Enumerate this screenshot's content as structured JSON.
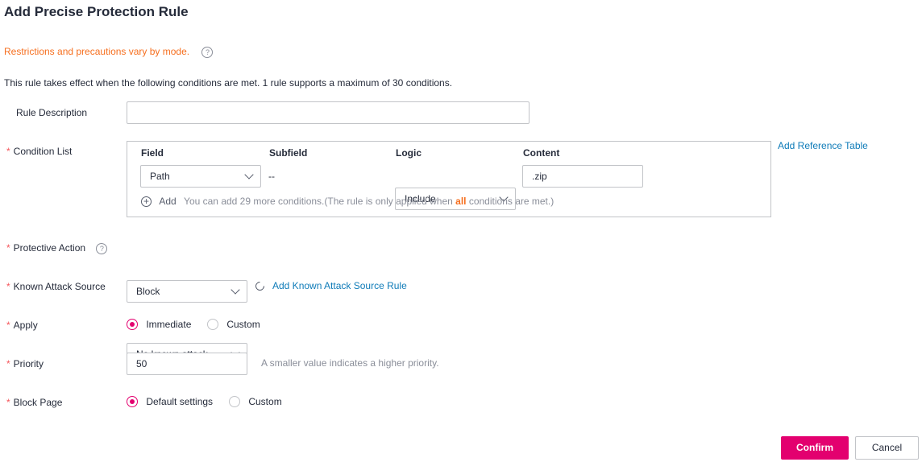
{
  "dialog": {
    "title": "Add Precise Protection Rule",
    "warning": "Restrictions and precautions vary by mode.",
    "description": "This rule takes effect when the following conditions are met. 1 rule supports a maximum of 30 conditions."
  },
  "form": {
    "rule_description": {
      "label": "Rule Description",
      "value": "",
      "placeholder": ""
    },
    "condition_list": {
      "label": "Condition List",
      "columns": [
        "Field",
        "Subfield",
        "Logic",
        "Content"
      ],
      "rows": [
        {
          "field": "Path",
          "subfield": "--",
          "logic": "Include",
          "content": ".zip"
        }
      ],
      "add_label": "Add",
      "add_hint_prefix": "You can add 29 more conditions.(The rule is only applied when ",
      "add_hint_highlight": "all",
      "add_hint_suffix": " conditions are met.)",
      "reference_link": "Add Reference Table"
    },
    "protective_action": {
      "label": "Protective Action",
      "value": "Block"
    },
    "known_attack_source": {
      "label": "Known Attack Source",
      "value": "No known attack...",
      "link": "Add Known Attack Source Rule"
    },
    "apply": {
      "label": "Apply",
      "options": [
        "Immediate",
        "Custom"
      ],
      "selected": "Immediate"
    },
    "priority": {
      "label": "Priority",
      "value": "50",
      "hint": "A smaller value indicates a higher priority."
    },
    "block_page": {
      "label": "Block Page",
      "options": [
        "Default settings",
        "Custom"
      ],
      "selected": "Default settings"
    }
  },
  "footer": {
    "confirm": "Confirm",
    "cancel": "Cancel"
  },
  "colors": {
    "accent": "#e3006f",
    "warning": "#f66f1f",
    "link": "#0e7bb8",
    "required": "#f5565b"
  }
}
